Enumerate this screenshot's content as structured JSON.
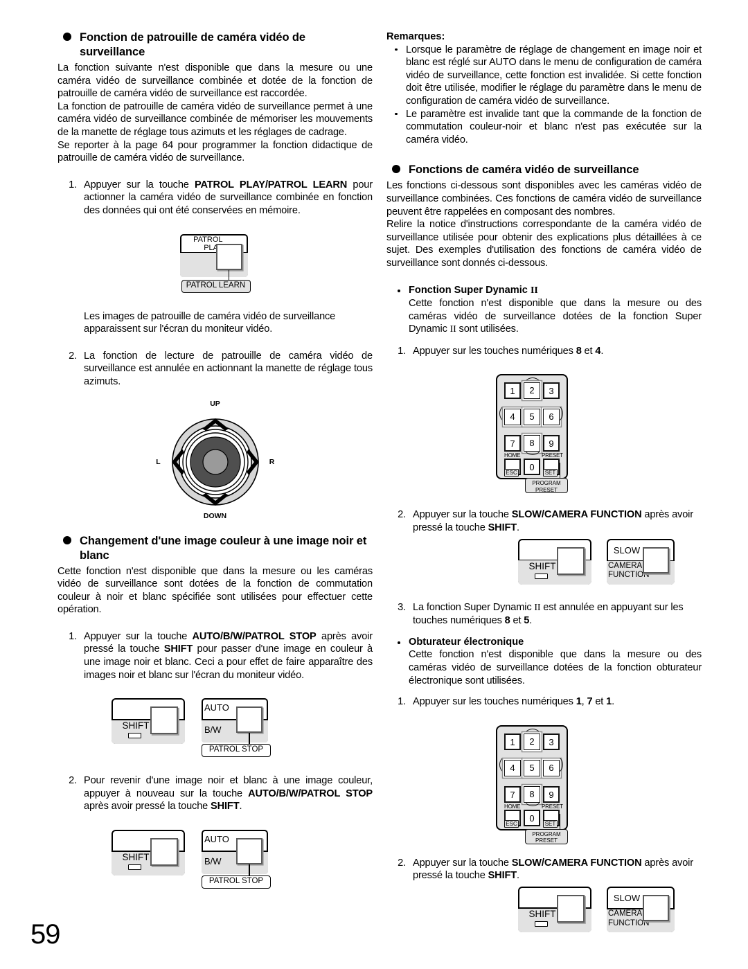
{
  "page": {
    "number": "59"
  },
  "left_column": {
    "section1": {
      "heading": "Fonction de patrouille de caméra vidéo de surveillance",
      "para1": "La fonction suivante n'est disponible que dans la mesure ou une caméra vidéo de surveillance combinée et dotée de la fonction de patrouille de caméra vidéo de surveillance est raccordée.",
      "para2": "La fonction de patrouille de caméra vidéo de surveillance permet à une caméra vidéo de surveillance combinée de mémoriser les mouvements de la manette de réglage tous azimuts et les réglages de cadrage.",
      "para3": "Se reporter à la page 64 pour programmer la fonction didactique de patrouille de caméra vidéo de surveillance.",
      "step1_num": "1.",
      "step1_a": "Appuyer sur la touche ",
      "step1_b1": "PATROL PLAY/PATROL LEARN",
      "step1_c": " pour actionner la caméra vidéo de surveillance combinée en fonction des données qui ont été conservées en mémoire.",
      "after_fig1": "Les images de patrouille de caméra vidéo de surveillance apparaissent sur l'écran du moniteur vidéo.",
      "step2_num": "2.",
      "step2_text": "La fonction de lecture de patrouille de caméra vidéo de surveillance est annulée en actionnant la manette de réglage tous azimuts."
    },
    "patrol_button": {
      "label_line1": "PATROL",
      "label_line2": "PLAY",
      "caption": "PATROL LEARN"
    },
    "joystick": {
      "up": "UP",
      "down": "DOWN",
      "left": "L",
      "right": "R"
    },
    "section2": {
      "heading": "Changement d'une image couleur à une image noir et blanc",
      "para1": "Cette fonction n'est disponible que dans la mesure ou les caméras vidéo de surveillance sont dotées de la fonction de commutation couleur à noir et blanc spécifiée sont utilisées pour effectuer cette opération.",
      "step1_num": "1.",
      "step1_a": "Appuyer sur la touche ",
      "step1_b1": "AUTO/B/W/PATROL STOP",
      "step1_c": " après avoir pressé la touche ",
      "step1_b2": "SHIFT",
      "step1_d": " pour passer d'une image en couleur à une image noir et blanc. Ceci a pour effet de faire apparaître des images noir et blanc sur l'écran du moniteur vidéo.",
      "step2_num": "2.",
      "step2_a": "Pour revenir d'une image noir et blanc à une image couleur, appuyer à nouveau sur la touche ",
      "step2_b1": "AUTO/B/W/PATROL STOP",
      "step2_c": " après avoir pressé la touche ",
      "step2_b2": "SHIFT",
      "step2_d": "."
    },
    "shift_button": {
      "label": "SHIFT"
    },
    "auto_button": {
      "label_top": "AUTO",
      "label_bottom": "B/W",
      "caption": "PATROL STOP"
    }
  },
  "right_column": {
    "remarques": {
      "title": "Remarques:",
      "items": [
        "Lorsque le paramètre de réglage de changement en image noir et blanc est réglé sur AUTO dans le menu de configuration de caméra vidéo de surveillance, cette fonction est invalidée. Si cette fonction doit être utilisée, modifier le réglage du paramètre dans le menu de configuration de caméra vidéo de surveillance.",
        "Le paramètre est invalide tant que la commande de la fonction de commutation couleur-noir et blanc n'est pas exécutée sur la caméra vidéo."
      ]
    },
    "section3": {
      "heading": "Fonctions de caméra vidéo de surveillance",
      "para1": "Les fonctions ci-dessous sont disponibles avec les caméras vidéo de surveillance combinées. Ces fonctions de caméra vidéo de surveillance peuvent être rappelées en composant des nombres.",
      "para2": "Relire la notice d'instructions correspondante de la caméra vidéo de surveillance utilisée pour obtenir des explications plus détaillées à ce sujet. Des exemples d'utilisation des fonctions de caméra vidéo de surveillance sont donnés ci-dessous."
    },
    "super_dynamic": {
      "heading_a": "Fonction Super Dynamic ",
      "heading_numeral": "II",
      "body_a": "Cette fonction n'est disponible que dans la mesure ou des caméras vidéo de surveillance dotées de la fonction Super Dynamic ",
      "body_numeral": "II",
      "body_b": " sont utilisées.",
      "step1_num": "1.",
      "step1_a": "Appuyer sur les touches numériques ",
      "step1_k1": "8",
      "step1_b": " et ",
      "step1_k2": "4",
      "step1_c": ".",
      "step2_num": "2.",
      "step2_a": "Appuyer sur la touche ",
      "step2_b1": "SLOW/CAMERA FUNCTION",
      "step2_c": " après avoir pressé la touche ",
      "step2_b2": "SHIFT",
      "step2_d": ".",
      "step3_num": "3.",
      "step3_a": "La fonction Super Dynamic ",
      "step3_numeral": "II",
      "step3_b": " est annulée en appuyant sur les touches numériques ",
      "step3_k1": "8",
      "step3_c": " et ",
      "step3_k2": "5",
      "step3_d": "."
    },
    "obturateur": {
      "heading": "Obturateur électronique",
      "body": "Cette fonction n'est disponible que dans la mesure ou des caméras vidéo de surveillance dotées de la fonction obturateur électronique sont utilisées.",
      "step1_num": "1.",
      "step1_a": "Appuyer sur les touches numériques ",
      "step1_k1": "1",
      "step1_b": ", ",
      "step1_k2": "7",
      "step1_c": " et ",
      "step1_k3": "1",
      "step1_d": ".",
      "step2_num": "2.",
      "step2_a": "Appuyer sur la touche ",
      "step2_b1": "SLOW/CAMERA FUNCTION",
      "step2_c": " après avoir pressé la touche ",
      "step2_b2": "SHIFT",
      "step2_d": "."
    },
    "shift_button": {
      "label": "SHIFT"
    },
    "slow_button": {
      "label_top": "SLOW",
      "label_bottom_1": "CAMERA",
      "label_bottom_2": "FUNCTION"
    },
    "keypad": {
      "keys": [
        "1",
        "2",
        "3",
        "4",
        "5",
        "6",
        "7",
        "8",
        "9",
        "0"
      ],
      "home_label": "HOME",
      "esc_label": "ESC",
      "preset_label": "PRESET",
      "set_label": "SET",
      "callout_line1": "PROGRAM",
      "callout_line2": "PRESET"
    }
  }
}
